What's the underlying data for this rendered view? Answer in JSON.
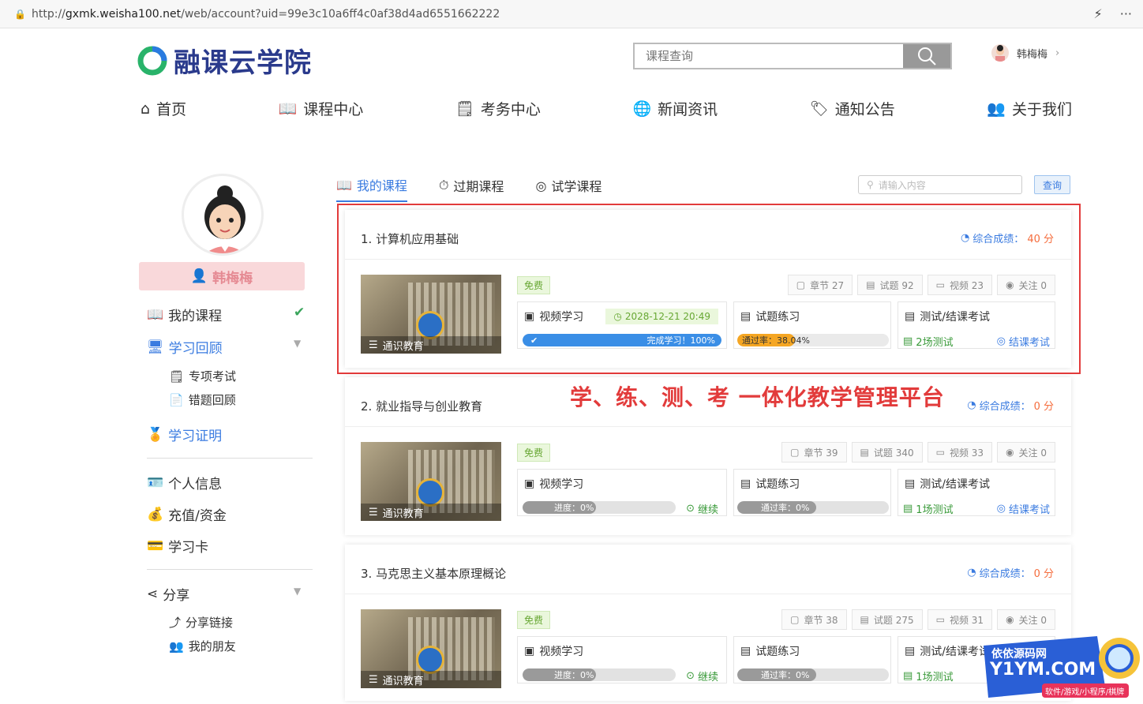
{
  "browser": {
    "url_prefix": "http://",
    "url_domain": "gxmk.weisha100.net",
    "url_path": "/web/account?uid=99e3c10a6ff4c0af38d4ad6551662222"
  },
  "header": {
    "site_name": "融课云学院",
    "search_placeholder": "课程查询",
    "username": "韩梅梅"
  },
  "nav": [
    "首页",
    "课程中心",
    "考务中心",
    "新闻资讯",
    "通知公告",
    "关于我们"
  ],
  "sidebar": {
    "name": "韩梅梅",
    "my_courses": "我的课程",
    "review": "学习回顾",
    "review_items": [
      "专项考试",
      "错题回顾"
    ],
    "certificate": "学习证明",
    "profile": "个人信息",
    "recharge": "充值/资金",
    "study_card": "学习卡",
    "share": "分享",
    "share_items": [
      "分享链接",
      "我的朋友"
    ]
  },
  "tabs": [
    "我的课程",
    "过期课程",
    "试学课程"
  ],
  "filter": {
    "placeholder": "请输入内容",
    "button": "查询"
  },
  "score_label": "综合成绩：",
  "free_label": "免费",
  "thumb_caption": "通识教育",
  "box_labels": {
    "video": "视频学习",
    "practice": "试题练习",
    "exam": "测试/结课考试",
    "continue": "继续",
    "final_exam": "结课考试"
  },
  "courses": [
    {
      "title": "1. 计算机应用基础",
      "score": "40 分",
      "chapters": "章节 27",
      "questions": "试题 92",
      "videos": "视频 23",
      "follows": "关注 0",
      "expire": "2028-12-21 20:49",
      "progress_text": "完成学习！100%",
      "progress": 1.0,
      "pass_text": "通过率：38.04%",
      "pass": 0.3804,
      "tests": "2场测试"
    },
    {
      "title": "2. 就业指导与创业教育",
      "score": "0 分",
      "chapters": "章节 39",
      "questions": "试题 340",
      "videos": "视频 33",
      "follows": "关注 0",
      "progress_text": "进度：0%",
      "progress": 0,
      "pass_text": "通过率：0%",
      "pass": 0,
      "tests": "1场测试"
    },
    {
      "title": "3. 马克思主义基本原理概论",
      "score": "0 分",
      "chapters": "章节 38",
      "questions": "试题 275",
      "videos": "视频 31",
      "follows": "关注 0",
      "progress_text": "进度：0%",
      "progress": 0,
      "pass_text": "通过率：0%",
      "pass": 0,
      "tests": "1场测试"
    }
  ],
  "promo": "学、练、测、考 一体化教学管理平台",
  "watermark": {
    "line1": "依依源码网",
    "line2": "Y1YM.COM",
    "line3": "软件/游戏/小程序/棋牌"
  },
  "colors": {
    "accent": "#3a7be0",
    "brand": "#2a3a8c",
    "green": "#67a733",
    "red": "#e23b3b",
    "orange": "#f5a623"
  }
}
